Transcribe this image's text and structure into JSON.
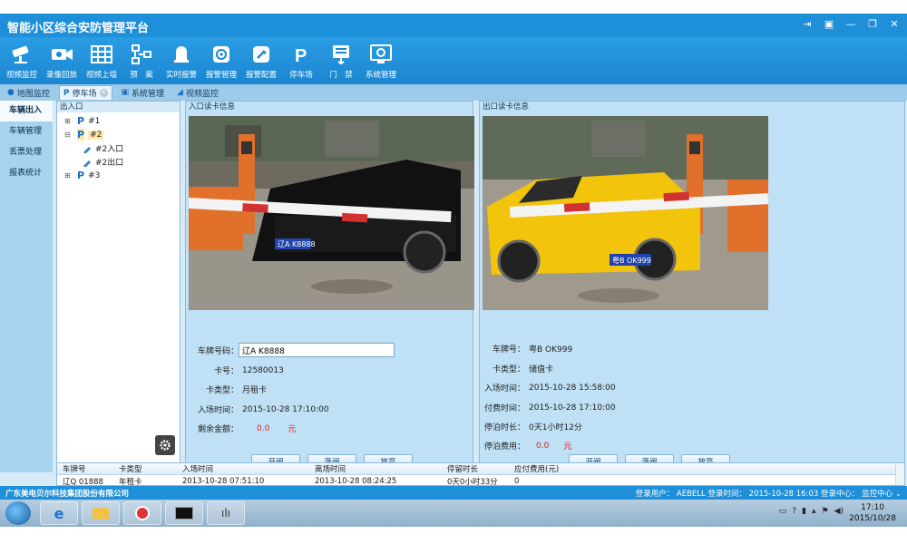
{
  "app": {
    "title": "智能小区综合安防管理平台"
  },
  "toolbar": {
    "items": [
      {
        "label": "视频监控",
        "icon": "camera-icon"
      },
      {
        "label": "录像回放",
        "icon": "video-playback-icon"
      },
      {
        "label": "视频上墙",
        "icon": "video-wall-icon"
      },
      {
        "label": "预　案",
        "icon": "plan-flowchart-icon"
      },
      {
        "label": "实时报警",
        "icon": "alarm-bell-icon"
      },
      {
        "label": "报警管理",
        "icon": "alarm-manage-icon"
      },
      {
        "label": "报警配置",
        "icon": "alarm-config-icon"
      },
      {
        "label": "停车场",
        "icon": "parking-icon"
      },
      {
        "label": "门　禁",
        "icon": "access-control-icon"
      },
      {
        "label": "系统管理",
        "icon": "system-manage-icon"
      }
    ]
  },
  "tabs": [
    {
      "label": "地图监控"
    },
    {
      "label": "停车场"
    },
    {
      "label": "系统管理"
    },
    {
      "label": "视频监控"
    }
  ],
  "leftnav": [
    {
      "label": "车辆出入"
    },
    {
      "label": "车辆管理"
    },
    {
      "label": "丢票处理"
    },
    {
      "label": "报表统计"
    }
  ],
  "tree": {
    "title": "出入口",
    "lots": [
      {
        "label": "#1"
      },
      {
        "label": "#2",
        "children": [
          "#2入口",
          "#2出口"
        ]
      },
      {
        "label": "#3"
      }
    ]
  },
  "entry": {
    "title": "入口读卡信息",
    "plate_label": "车牌号码：",
    "plate_value": "辽A K8888",
    "card_no_label": "卡号：",
    "card_no": "12580013",
    "card_type_label": "卡类型：",
    "card_type": "月租卡",
    "entry_time_label": "入场时间：",
    "entry_time": "2015-10-28 17:10:00",
    "balance_label": "剩余金额：",
    "balance": "0.0",
    "balance_unit": "元",
    "buttons": {
      "open": "开闸",
      "close": "落闸",
      "discard": "放弃"
    }
  },
  "exit": {
    "title": "出口读卡信息",
    "plate_label": "车牌号：",
    "plate_value": "粤B OK999",
    "card_type_label": "卡类型：",
    "card_type": "储值卡",
    "entry_time_label": "入场时间：",
    "entry_time": "2015-10-28 15:58:00",
    "pay_time_label": "付费时间：",
    "pay_time": "2015-10-28 17:10:00",
    "duration_label": "停泊时长：",
    "duration": "0天1小时12分",
    "fee_label": "停泊费用：",
    "fee": "0.0",
    "fee_unit": "元",
    "buttons": {
      "open": "开闸",
      "close": "落闸",
      "discard": "放弃"
    }
  },
  "table": {
    "headers": [
      "车牌号",
      "卡类型",
      "入场时间",
      "离场时间",
      "停留时长",
      "应付费用(元)"
    ],
    "rows": [
      [
        "辽Q 01888",
        "年租卡",
        "2013-10-28 07:51:10",
        "2013-10-28 08:24:25",
        "0天0小时33分",
        "0"
      ]
    ]
  },
  "status": {
    "company": "广东美电贝尔科技集团股份有限公司",
    "right": "登录用户： AEBELL  登录时间： 2015-10-28 16:03  登录中心： 监控中心 ⌄"
  },
  "taskbar": {
    "time": "17:10",
    "date": "2015/10/28"
  },
  "colors": {
    "brand": "#1e8fd9",
    "panel": "#bfe0f5",
    "accent_red": "#e02020"
  }
}
